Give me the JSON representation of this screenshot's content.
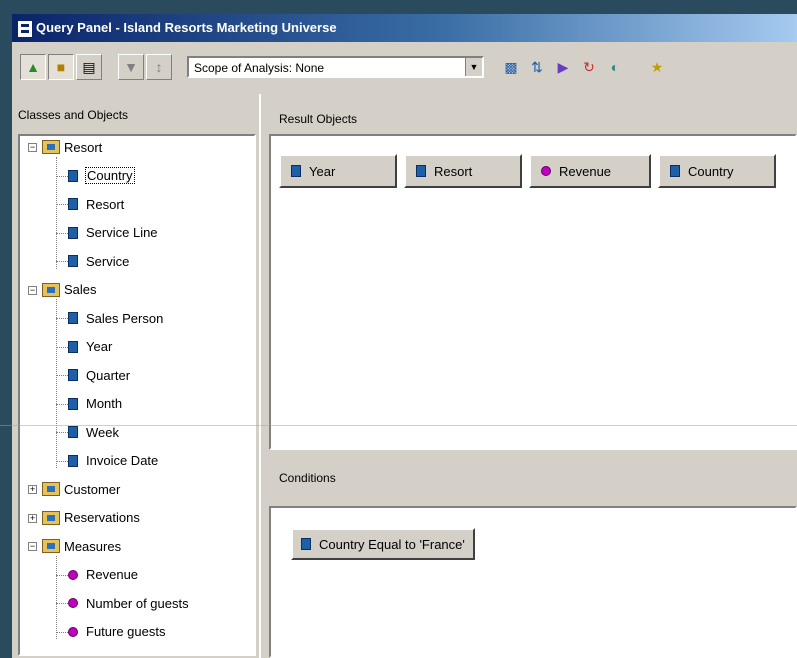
{
  "window": {
    "title": "Query Panel - Island Resorts Marketing Universe"
  },
  "toolbar": {
    "scope_label": "Scope of Analysis: None",
    "icons": [
      "classes-objects-icon",
      "predefined-conditions-icon",
      "functions-icon",
      "filter-icon",
      "sort-icon",
      "sql-icon",
      "options-icon",
      "run-icon",
      "refresh-icon",
      "view-icon",
      "help-icon"
    ]
  },
  "left": {
    "label": "Classes and Objects",
    "tree": [
      {
        "label": "Resort",
        "type": "class",
        "expanded": true,
        "children": [
          "Country",
          "Resort",
          "Service Line",
          "Service"
        ]
      },
      {
        "label": "Sales",
        "type": "class",
        "expanded": true,
        "children": [
          "Sales Person",
          "Year",
          "Quarter",
          "Month",
          "Week",
          "Invoice Date"
        ]
      },
      {
        "label": "Customer",
        "type": "class",
        "expanded": false
      },
      {
        "label": "Reservations",
        "type": "class",
        "expanded": false
      },
      {
        "label": "Measures",
        "type": "class",
        "expanded": true,
        "children": [
          "Revenue",
          "Number of guests",
          "Future guests"
        ]
      }
    ],
    "selected": "Country"
  },
  "right": {
    "results_label": "Result Objects",
    "results": [
      {
        "label": "Year",
        "kind": "dimension"
      },
      {
        "label": "Resort",
        "kind": "dimension"
      },
      {
        "label": "Revenue",
        "kind": "measure"
      },
      {
        "label": "Country",
        "kind": "dimension"
      }
    ],
    "conditions_label": "Conditions",
    "condition": "Country Equal to 'France'"
  },
  "colors": {
    "title_start": "#0a246a",
    "title_end": "#a6caf0",
    "dimension": "#1f5fa8",
    "measure": "#c000c0",
    "background": "#2a4a5e"
  }
}
